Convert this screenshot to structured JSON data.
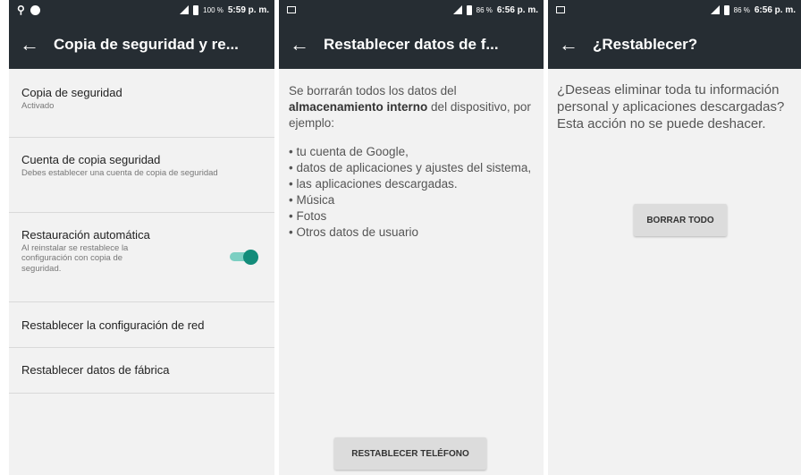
{
  "screen1": {
    "status": {
      "battery_pct": "100 %",
      "time": "5:59 p. m."
    },
    "title": "Copia de seguridad y re...",
    "prefs": [
      {
        "title": "Copia de seguridad",
        "summary": "Activado"
      },
      {
        "title": "Cuenta de copia seguridad",
        "summary": "Debes establecer una cuenta de copia de seguridad"
      },
      {
        "title": "Restauración automática",
        "summary": "Al reinstalar se restablece la configuración con copia de seguridad.",
        "toggle_on": true
      },
      {
        "title": "Restablecer la configuración de red"
      },
      {
        "title": "Restablecer datos de fábrica"
      }
    ]
  },
  "screen2": {
    "status": {
      "battery_pct": "86 %",
      "time": "6:56 p. m."
    },
    "title": "Restablecer datos de f...",
    "intro_before": "Se borrarán todos los datos del ",
    "intro_bold": "almacenamiento interno",
    "intro_after": " del dispositivo, por ejemplo:",
    "bullets": [
      "tu cuenta de Google,",
      "datos de aplicaciones y ajustes del sistema,",
      "las aplicaciones descargadas.",
      "Música",
      "Fotos",
      "Otros datos de usuario"
    ],
    "button": "RESTABLECER TELÉFONO"
  },
  "screen3": {
    "status": {
      "battery_pct": "86 %",
      "time": "6:56 p. m."
    },
    "title": "¿Restablecer?",
    "message": "¿Deseas eliminar toda tu información personal y aplicaciones descargadas? Esta acción no se puede deshacer.",
    "button": "BORRAR TODO"
  },
  "colors": {
    "appbar": "#262d33",
    "accent": "#138c7a",
    "background": "#f2f2f2"
  }
}
